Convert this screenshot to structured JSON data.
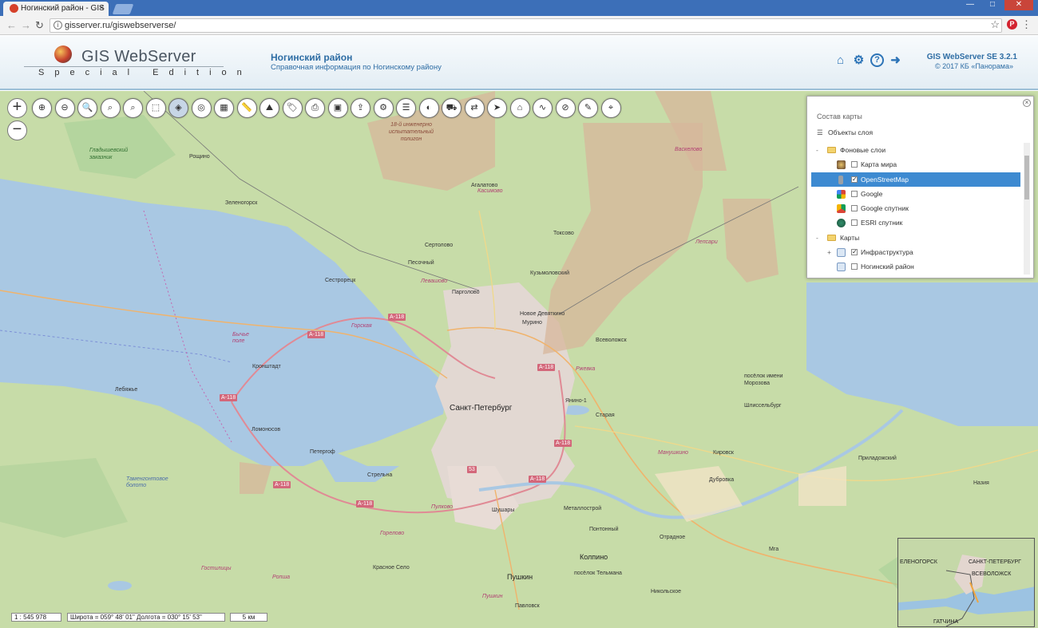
{
  "browser": {
    "tab_title": "Ногинский район - GIS",
    "tab_close": "×",
    "url": "gisserver.ru/giswebserverse/"
  },
  "header": {
    "logo_title": "GIS WebServer",
    "logo_subtitle": "Special Edition",
    "region_title": "Ногинский район",
    "region_subtitle": "Справочная информация по Ногинскому району",
    "icons": [
      "home-icon",
      "settings-icon",
      "help-icon",
      "login-icon"
    ],
    "version": "GIS WebServer SE 3.2.1",
    "copyright": "© 2017 КБ «Панорама»"
  },
  "map_toolbar": {
    "zoom_in": "+",
    "zoom_out": "−",
    "tools": [
      "zoom-in-area",
      "zoom-out-area",
      "search",
      "search-address",
      "search-area",
      "select-area",
      "layers",
      "radius",
      "grid",
      "ruler",
      "area-measure",
      "tag",
      "print",
      "screenshot",
      "share",
      "settings",
      "legend",
      "builder",
      "route",
      "transfer",
      "navigate",
      "objects",
      "path",
      "hide-tools",
      "draw",
      "marker"
    ]
  },
  "layer_panel": {
    "title": "Состав карты",
    "objects_label": "Объекты слоя",
    "tree": [
      {
        "type": "folder",
        "label": "Фоновые слои",
        "toggle": "-"
      },
      {
        "type": "layer",
        "label": "Карта мира",
        "checked": false,
        "icon": "world-map-icon"
      },
      {
        "type": "layer",
        "label": "OpenStreetMap",
        "checked": true,
        "selected": true,
        "icon": "osm-icon"
      },
      {
        "type": "layer",
        "label": "Google",
        "checked": false,
        "icon": "google-icon"
      },
      {
        "type": "layer",
        "label": "Google спутник",
        "checked": false,
        "icon": "google-satellite-icon"
      },
      {
        "type": "layer",
        "label": "ESRI спутник",
        "checked": false,
        "icon": "esri-icon"
      },
      {
        "type": "folder",
        "label": "Карты",
        "toggle": "-"
      },
      {
        "type": "layer",
        "label": "Инфраструктура",
        "checked": true,
        "icon": "layer-icon",
        "toggle": "+"
      },
      {
        "type": "layer",
        "label": "Ногинский район",
        "checked": false,
        "icon": "layer-icon"
      }
    ]
  },
  "status_bar": {
    "scale": "1 : 545 978",
    "coords": "Широта = 059° 48' 01\" Долгота = 030° 15' 53\"",
    "scale_bar": "5 км"
  },
  "map_labels": {
    "spb": "Санкт-Петербург",
    "kronshtadt": "Кронштадт",
    "sestroretsk": "Сестрорецк",
    "zelenogorsk": "Зеленогорск",
    "roshchino": "Рощино",
    "sertolovo": "Сертолово",
    "pesochny": "Песочный",
    "pargolovo": "Парголово",
    "agalatovo": "Агалатово",
    "toksovo": "Токсово",
    "kuzmolovsky": "Кузьмоловский",
    "novoe_devyatkino": "Новое Девяткино",
    "murino": "Мурино",
    "vsevolozhsk": "Всеволожск",
    "yanino": "Янино-1",
    "staraya": "Старая",
    "lomonosov": "Ломоносов",
    "peterhof": "Петергоф",
    "strelna": "Стрельна",
    "shushary": "Шушары",
    "metallostroy": "Металлострой",
    "pontonny": "Понтонный",
    "kolpino": "Колпино",
    "pushkin": "Пушкин",
    "krasnoe_selo": "Красное Село",
    "tel_mana": "посёлок Тельмана",
    "nikolskoe": "Никольское",
    "otradnoe": "Отрадное",
    "kirovsk": "Кировск",
    "shlisselburg": "Шлиссельбург",
    "morozova": "посёлок имени Морозова",
    "dubrovka": "Дубровка",
    "pavlovsk": "Павловск",
    "lebyazhe": "Лебяжье",
    "mga": "Мга",
    "nazia": "Назия",
    "priladozhsky": "Приладожский",
    "gladyshevsky": "Гладышевский заказник",
    "polygon": "18-й инженерно испытательный полигон",
    "levashovo": "Левашово",
    "gorskaya": "Горская",
    "bychye_pole": "Бычье поле",
    "kasimovo": "Касимово",
    "vaskelovo": "Васкелово",
    "lepsari": "Лепсари",
    "rzhevka": "Ржевка",
    "pulkovo": "Пулково",
    "gorelovo": "Горелово",
    "gostilitsy": "Гостилицы",
    "ropsha": "Ропша",
    "tamengontovoe": "Таменгонтовое болото",
    "manushkino": "Манушкино",
    "pushkin_air": "Пушкин",
    "a118": "A-118",
    "e53": "53"
  },
  "minimap": {
    "label_spb": "САНКТ-ПЕТЕРБУРГ",
    "label_vsev": "ВСЕВОЛОЖСК",
    "label_zel": "ЕЛЕНОГОРСК",
    "label_gat": "ГАТЧИНА"
  }
}
